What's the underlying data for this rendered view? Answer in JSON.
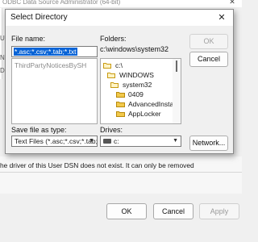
{
  "background_window": {
    "title": "ODBC Data Source Administrator (64-bit)",
    "close_symbol": "✕",
    "side_letters": [
      "U",
      "N",
      "D"
    ],
    "message": "he driver of this User DSN does not exist. It can only be removed",
    "buttons": {
      "ok": "OK",
      "cancel": "Cancel",
      "apply": "Apply"
    }
  },
  "dialog": {
    "title": "Select Directory",
    "close_symbol": "✕",
    "file_name": {
      "label": "File name:",
      "value": "*.asc;*.csv;*.tab;*.txt"
    },
    "file_list": [
      "ThirdPartyNoticesBySH"
    ],
    "folders": {
      "label": "Folders:",
      "current_path": "c:\\windows\\system32",
      "items": [
        {
          "name": "c:\\",
          "icon": "open-folder-icon",
          "selected": false
        },
        {
          "name": "WINDOWS",
          "icon": "open-folder-icon",
          "selected": false
        },
        {
          "name": "system32",
          "icon": "open-folder-icon",
          "selected": true
        },
        {
          "name": "0409",
          "icon": "folder-icon",
          "selected": false
        },
        {
          "name": "AdvancedInstallers",
          "icon": "folder-icon",
          "selected": false
        },
        {
          "name": "AppLocker",
          "icon": "folder-icon",
          "selected": false
        }
      ]
    },
    "save_type": {
      "label": "Save file as type:",
      "value": "Text Files (*.asc;*.csv;*.tab;*.txt)"
    },
    "drives": {
      "label": "Drives:",
      "value": "c:"
    },
    "buttons": {
      "ok": "OK",
      "cancel": "Cancel",
      "network": "Network..."
    },
    "colors": {
      "selection": "#0a64d6",
      "folder_yellow": "#e8b320",
      "disabled_text": "#a0a0a0"
    }
  }
}
